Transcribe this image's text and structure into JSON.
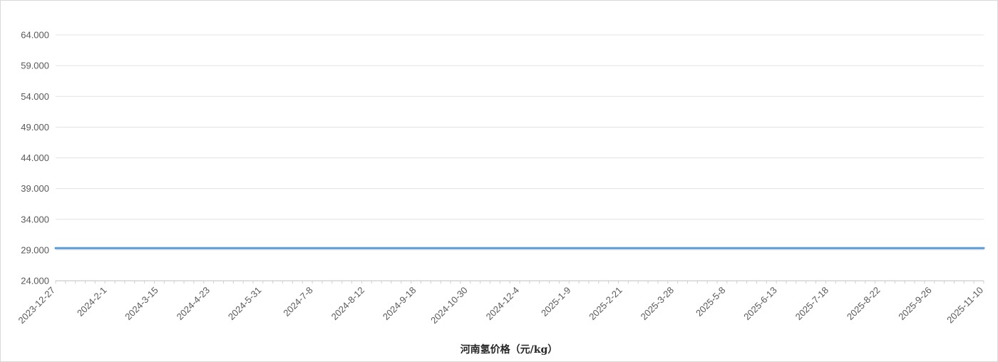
{
  "chart_data": {
    "type": "line",
    "title": "",
    "xlabel": "河南氢价格（元/kg）",
    "ylabel": "",
    "ylim": [
      24.0,
      64.0
    ],
    "y_ticks": [
      "24.000",
      "29.000",
      "34.000",
      "39.000",
      "44.000",
      "49.000",
      "54.000",
      "59.000",
      "64.000"
    ],
    "x_tick_labels": [
      "2023-12-27",
      "2024-2-1",
      "2024-3-15",
      "2024-4-23",
      "2024-5-31",
      "2024-7-8",
      "2024-8-12",
      "2024-9-18",
      "2024-10-30",
      "2024-12-4",
      "2025-1-9",
      "2025-2-21",
      "2025-3-28",
      "2025-5-8",
      "2025-6-13",
      "2025-7-18",
      "2025-8-22",
      "2025-9-26",
      "2025-11-10"
    ],
    "grid": true,
    "legend": "none",
    "series": [
      {
        "color": "#5b9bd5",
        "x": [
          "2023-12-27",
          "2025-11-10"
        ],
        "values": [
          29.3,
          29.3
        ]
      }
    ]
  }
}
